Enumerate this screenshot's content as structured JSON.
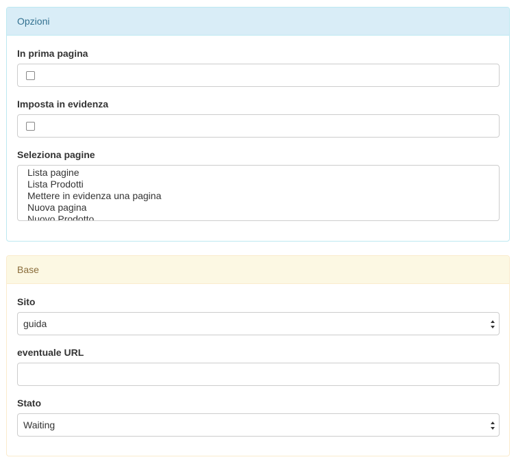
{
  "options_panel": {
    "title": "Opzioni",
    "front_page_label": "In prima pagina",
    "featured_label": "Imposta in evidenza",
    "pages_label": "Seleziona pagine",
    "pages_options": [
      "Lista pagine",
      "Lista Prodotti",
      "Mettere in evidenza una pagina",
      "Nuova pagina",
      "Nuovo Prodotto"
    ]
  },
  "base_panel": {
    "title": "Base",
    "site_label": "Sito",
    "site_value": "guida",
    "url_label": "eventuale URL",
    "url_value": "",
    "status_label": "Stato",
    "status_value": "Waiting"
  },
  "colors": {
    "info_heading_bg": "#d9edf7",
    "info_heading_text": "#31708f",
    "warning_heading_bg": "#fcf8e3",
    "warning_heading_text": "#8a6d3b"
  }
}
